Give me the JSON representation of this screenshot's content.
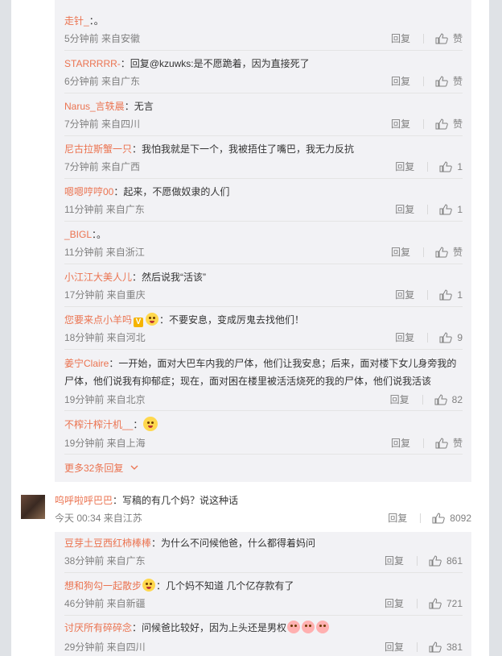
{
  "replies": [
    {
      "user": "走针_",
      "text": "：。",
      "time": "5分钟前 来自安徽",
      "reply_label": "回复",
      "likes": "赞"
    },
    {
      "user": "STARRRRR-",
      "text": "：回复@kzuwks:是不愿跪着，因为直接死了",
      "time": "6分钟前 来自广东",
      "reply_label": "回复",
      "likes": "赞"
    },
    {
      "user": "Narus_言轶晨",
      "text": "：无言",
      "time": "7分钟前 来自四川",
      "reply_label": "回复",
      "likes": "赞"
    },
    {
      "user": "尼古拉斯蟹一只",
      "text": "：我怕我就是下一个，我被捂住了嘴巴，我无力反抗",
      "time": "7分钟前 来自广西",
      "reply_label": "回复",
      "likes": "1"
    },
    {
      "user": "嗯嗯哼哼00",
      "text": "：起来，不愿做奴隶的人们",
      "time": "11分钟前 来自广东",
      "reply_label": "回复",
      "likes": "1"
    },
    {
      "user": "_BIGL",
      "text": "：。",
      "time": "11分钟前 来自浙江",
      "reply_label": "回复",
      "likes": "赞"
    },
    {
      "user": "小江江大美人儿",
      "text": "：然后说我“活该”",
      "time": "17分钟前 来自重庆",
      "reply_label": "回复",
      "likes": "1"
    },
    {
      "user": "您要来点小羊吗",
      "text": "：不要安息，变成厉鬼去找他们！",
      "time": "18分钟前 来自河北",
      "reply_label": "回复",
      "likes": "9"
    },
    {
      "user": "姜宁Claire",
      "text": "：一开始，面对大巴车内我的尸体，他们让我安息；后来，面对楼下女儿身旁我的尸体，他们说我有抑郁症；现在，面对困在楼里被活活烧死的我的尸体，他们说我活该",
      "time": "19分钟前 来自北京",
      "reply_label": "回复",
      "likes": "82"
    },
    {
      "user": "不榨汁榨汁机__",
      "text": "：",
      "time": "19分钟前 来自上海",
      "reply_label": "回复",
      "likes": "赞"
    }
  ],
  "more_replies": "更多32条回复",
  "main_comment": {
    "user": "呜呼啦呼巴巴",
    "text": "：写稿的有几个妈？说这种话",
    "time": "今天 00:34 来自江苏",
    "reply_label": "回复",
    "likes": "8092"
  },
  "sub_replies": [
    {
      "user": "豆芽土豆西红柿棒棒",
      "text": "：为什么不问候他爸，什么都得着妈问",
      "time": "38分钟前 来自广东",
      "reply_label": "回复",
      "likes": "861"
    },
    {
      "user": "想和狗勾一起散步",
      "text": "：几个妈不知道 几个亿存款有了",
      "time": "46分钟前 来自新疆",
      "reply_label": "回复",
      "likes": "721"
    },
    {
      "user": "讨厌所有碎碎念",
      "text": "：问候爸比较好，因为上头还是男权",
      "time": "29分钟前 来自四川",
      "reply_label": "回复",
      "likes": "381"
    }
  ],
  "colors": {
    "username": "#eb7350",
    "meta": "#808080",
    "thread_bg": "#f2f2f5"
  }
}
